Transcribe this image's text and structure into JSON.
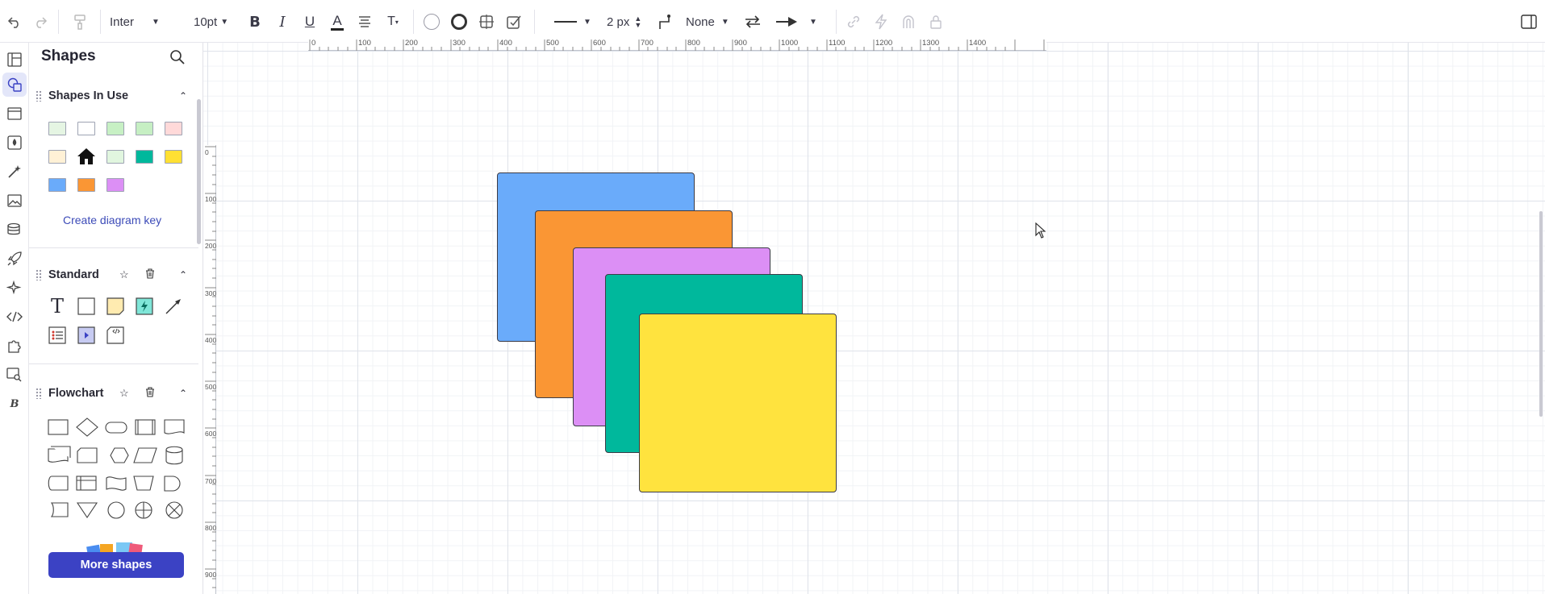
{
  "toolbar": {
    "font_family": "Inter",
    "font_size": "10pt",
    "line_width": "2 px",
    "arrow_start": "None",
    "colors": {
      "text_underline": "#222222"
    }
  },
  "panel": {
    "title": "Shapes",
    "sections": {
      "in_use": {
        "title": "Shapes In Use",
        "swatches": [
          "#e5f5e3",
          "#ffffff",
          "#c7f0c4",
          "#c6efc3",
          "#ffd9d9",
          "#fff1d6",
          "house",
          "#e1f6df",
          "#00b89c",
          "#ffe033",
          "#6aabfa",
          "#fa9634",
          "#dc8ff5"
        ],
        "link": "Create diagram key"
      },
      "standard": {
        "title": "Standard"
      },
      "flowchart": {
        "title": "Flowchart"
      }
    },
    "more_button": "More shapes"
  },
  "ruler": {
    "h_labels": [
      "0",
      "100",
      "200",
      "300",
      "400",
      "500",
      "600",
      "700",
      "800",
      "900",
      "1000",
      "1100",
      "1200",
      "1300",
      "1400"
    ],
    "v_labels": [
      "0",
      "100",
      "200",
      "300",
      "400",
      "500",
      "600",
      "700",
      "800",
      "900"
    ]
  },
  "canvas": {
    "shapes": [
      {
        "name": "blue-square",
        "color": "#6aabfa"
      },
      {
        "name": "orange-square",
        "color": "#fa9634"
      },
      {
        "name": "purple-square",
        "color": "#dc8ff5"
      },
      {
        "name": "teal-square",
        "color": "#00b89c"
      },
      {
        "name": "yellow-square",
        "color": "#ffe33e"
      }
    ]
  }
}
